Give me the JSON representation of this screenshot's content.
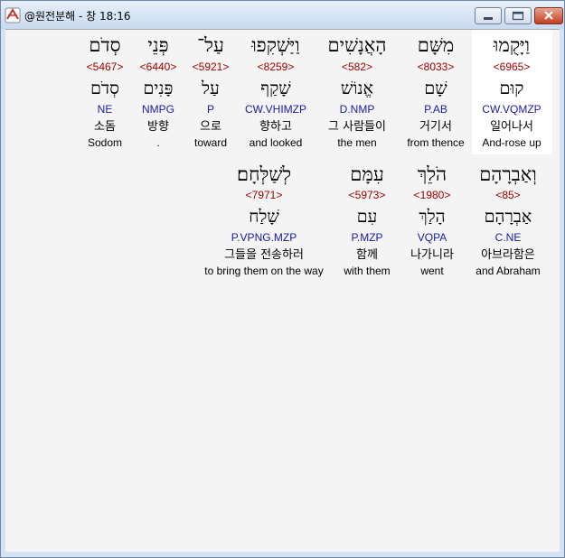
{
  "window": {
    "title": "@원전분해 - 창 18:16",
    "buttons": {
      "minimize": "minimize-icon",
      "maximize": "maximize-icon",
      "close": "close-icon"
    }
  },
  "rows": [
    {
      "words": [
        {
          "hebrew": "וַיָּקֻמוּ",
          "strongs": "<6965>",
          "lemma": "קוּם",
          "parse": "CW.VQMZP",
          "korean": "일어나서",
          "english": "And-rose up",
          "selected": true
        },
        {
          "hebrew": "מִשָּׁם",
          "strongs": "<8033>",
          "lemma": "שָׁם",
          "parse": "P.AB",
          "korean": "거기서",
          "english": "from thence"
        },
        {
          "hebrew": "הָאֲנָשִׁים",
          "strongs": "<582>",
          "lemma": "אֱנוֹשׁ",
          "parse": "D.NMP",
          "korean": "그 사람들이",
          "english": "the men"
        },
        {
          "hebrew": "וַיַּשְׁקִפוּ",
          "strongs": "<8259>",
          "lemma": "שָׁקַף",
          "parse": "CW.VHIMZP",
          "korean": "향하고",
          "english": "and looked"
        },
        {
          "hebrew": "עַל־",
          "strongs": "<5921>",
          "lemma": "עַל",
          "parse": "P",
          "korean": "으로",
          "english": "toward"
        },
        {
          "hebrew": "פְּנֵי",
          "strongs": "<6440>",
          "lemma": "פָּנִים",
          "parse": "NMPG",
          "korean": "방향",
          "english": "."
        },
        {
          "hebrew": "סְדֹם",
          "strongs": "<5467>",
          "lemma": "סְדֹם",
          "parse": "NE",
          "korean": "소돔",
          "english": "Sodom"
        }
      ]
    },
    {
      "words": [
        {
          "hebrew": "וְאַבְרָהָם",
          "strongs": "<85>",
          "lemma": "אַבְרָהָם",
          "parse": "C.NE",
          "korean": "아브라함은",
          "english": "and Abraham"
        },
        {
          "hebrew": "הֹלֵךְ",
          "strongs": "<1980>",
          "lemma": "הָלַךְ",
          "parse": "VQPA",
          "korean": "나가니라",
          "english": "went"
        },
        {
          "hebrew": "עִמָּם",
          "strongs": "<5973>",
          "lemma": "עִם",
          "parse": "P.MZP",
          "korean": "함께",
          "english": "with them"
        },
        {
          "hebrew": "לְשַׁלְּחָם׃",
          "strongs": "<7971>",
          "lemma": "שָׁלַח",
          "parse": "P.VPNG.MZP",
          "korean": "그들을 전송하러",
          "english": "to bring them on the way"
        }
      ]
    }
  ]
}
